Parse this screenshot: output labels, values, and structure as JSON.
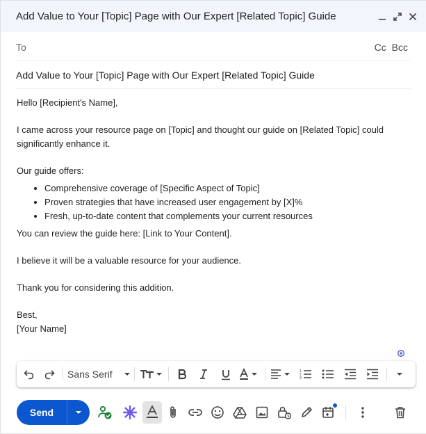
{
  "header": {
    "title": "Add Value to Your [Topic] Page with Our Expert [Related Topic] Guide"
  },
  "to": {
    "label": "To",
    "cc": "Cc",
    "bcc": "Bcc"
  },
  "subject": {
    "value": "Add Value to Your [Topic] Page with Our Expert [Related Topic] Guide"
  },
  "body": {
    "greeting": "Hello [Recipient's Name],",
    "intro": "I came across your resource page on [Topic] and thought our guide on [Related Topic] could significantly enhance it.",
    "offers_heading": "Our guide offers:",
    "bullets": [
      "Comprehensive coverage of [Specific Aspect of Topic]",
      "Proven strategies that have increased user engagement by [X]%",
      "Fresh, up-to-date content that complements your current resources"
    ],
    "review": "You can review the guide here: [Link to Your Content].",
    "believe": "I believe it will be a valuable resource for your audience.",
    "thanks": "Thank you for considering this addition.",
    "signoff": "Best,",
    "name": "[Your Name]"
  },
  "toolbar": {
    "font": "Sans Serif"
  },
  "bottom": {
    "send_label": "Send"
  },
  "colors": {
    "send": "#0b57d0",
    "header_bg": "#f2f6fc",
    "gemini": "#6b5cf0",
    "schedule_green": "#188038"
  }
}
